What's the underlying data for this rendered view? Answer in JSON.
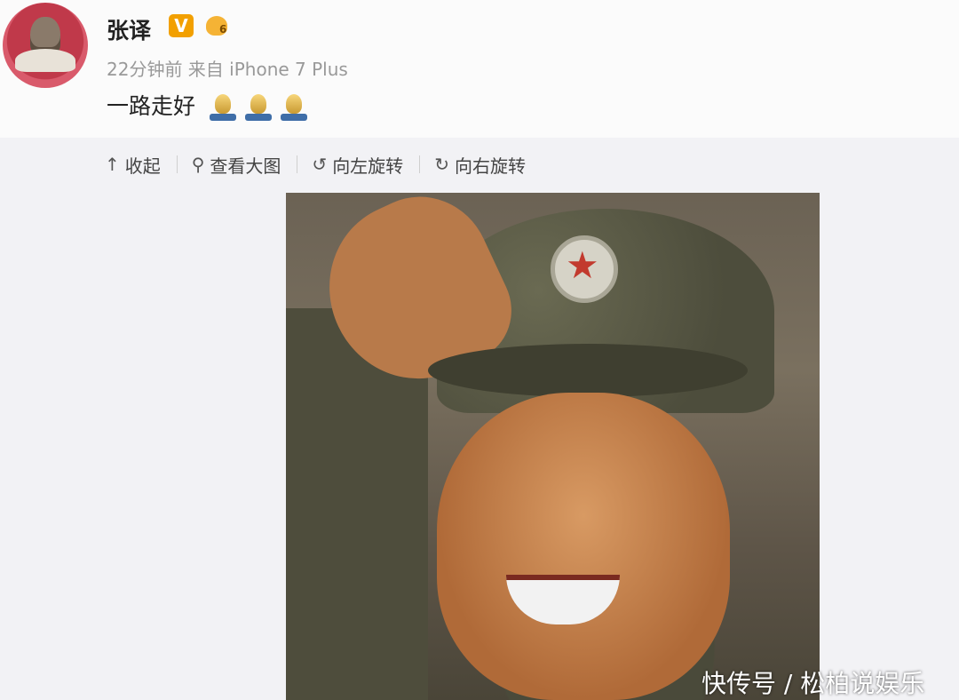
{
  "post": {
    "user_name": "张译",
    "verified_badge": "V",
    "level_badge": "6",
    "meta": "22分钟前 来自 iPhone 7 Plus",
    "text": "一路走好",
    "emoji_icons": [
      "candle-icon",
      "candle-icon",
      "candle-icon"
    ]
  },
  "toolbar": {
    "collapse_label": "收起",
    "view_large_label": "查看大图",
    "rotate_left_label": "向左旋转",
    "rotate_right_label": "向右旋转"
  },
  "watermark": "快传号 / 松柏说娱乐",
  "colors": {
    "verified": "#f2a000",
    "meta_text": "#999999",
    "background": "#f2f2f5"
  }
}
